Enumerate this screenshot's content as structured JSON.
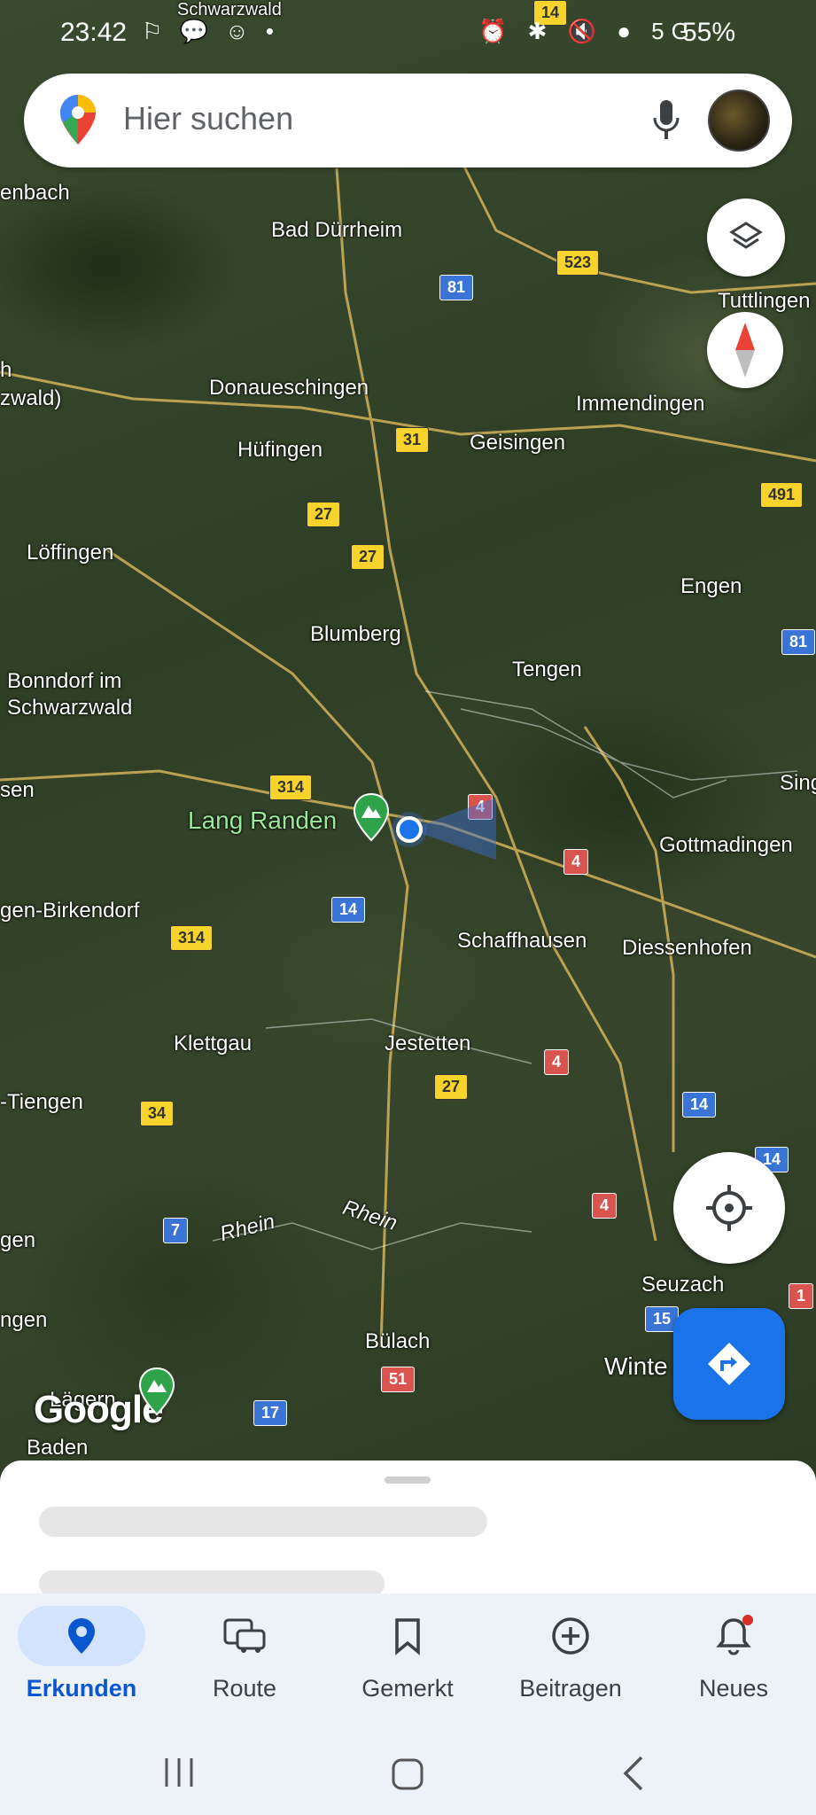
{
  "status_bar": {
    "time": "23:42",
    "notification_icons": "⚐ 💬 ☺ •",
    "system_icons": "⏰ ✱ 🔇 ● 5G",
    "battery": "55%"
  },
  "search": {
    "placeholder": "Hier suchen"
  },
  "map": {
    "places": {
      "bad_duerrheim": "Bad Dürrheim",
      "tuttlingen": "Tuttlingen",
      "donaueschingen": "Donaueschingen",
      "immendingen": "Immendingen",
      "huefingen": "Hüfingen",
      "geisingen": "Geisingen",
      "loeffingen": "Löffingen",
      "engen": "Engen",
      "blumberg": "Blumberg",
      "tengen": "Tengen",
      "bonndorf": "Bonndorf im\nSchwarzwald",
      "lang_randen": "Lang Randen",
      "gottmadingen": "Gottmadingen",
      "birkendorf": "gen-Birkendorf",
      "schaffhausen": "Schaffhausen",
      "diessenhofen": "Diessenhofen",
      "klettgau": "Klettgau",
      "jestetten": "Jestetten",
      "tiengen": "-Tiengen",
      "rhein1": "Rhein",
      "rhein2": "Rhein",
      "seuzach": "Seuzach",
      "buelach": "Bülach",
      "winterthur": "Winte",
      "baden": "Baden",
      "laegern": "Lägern",
      "enbach": "enbach",
      "wald": "zwald)",
      "h_edge": "h",
      "sen": "sen",
      "sing": "Sing",
      "gen1": "gen",
      "gen2": "ngen",
      "schwarzwald_top": "Schwarzwald"
    },
    "shields": {
      "s81a": "81",
      "s523": "523",
      "s31": "31",
      "s27a": "27",
      "s27b": "27",
      "s491": "491",
      "s81b": "81",
      "s314a": "314",
      "s4a": "4",
      "s4b": "4",
      "s14a": "14",
      "s314b": "314",
      "s4c": "4",
      "s27c": "27",
      "s34": "34",
      "s14b": "14",
      "s14c": "14",
      "s4d": "4",
      "s7": "7",
      "s15": "15",
      "s1": "1",
      "s51": "51",
      "s17": "17",
      "s14top": "14"
    },
    "google_logo": "Google"
  },
  "nav": {
    "items": [
      {
        "label": "Erkunden",
        "icon": "explore-pin-icon"
      },
      {
        "label": "Route",
        "icon": "commute-car-icon"
      },
      {
        "label": "Gemerkt",
        "icon": "bookmark-icon"
      },
      {
        "label": "Beitragen",
        "icon": "add-circle-icon"
      },
      {
        "label": "Neues",
        "icon": "bell-icon"
      }
    ]
  },
  "colors": {
    "accent": "#0b57d0",
    "fab_blue": "#1a73e8",
    "active_pill": "#d3e3fd",
    "nav_bg": "#edf1f8"
  }
}
